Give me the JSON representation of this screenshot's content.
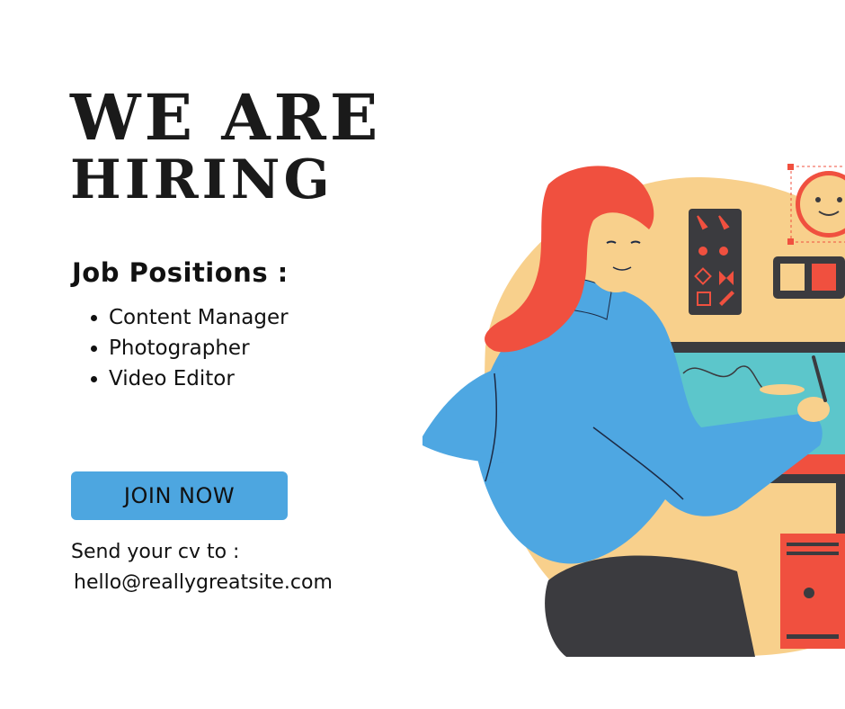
{
  "headline": {
    "line1": "WE ARE",
    "line2": "HIRING"
  },
  "positions": {
    "title": "Job Positions :",
    "items": [
      "Content Manager",
      "Photographer",
      "Video Editor"
    ]
  },
  "cta": {
    "label": "JOIN NOW"
  },
  "contact": {
    "label": "Send your cv to :",
    "email": "hello@reallygreatsite.com"
  },
  "colors": {
    "button": "#4da6e0",
    "blob": "#f8d08c",
    "hair": "#f0503f",
    "sweater": "#4ea7e2",
    "screen": "#5cc6cb",
    "dark": "#3b3b3f"
  },
  "illustration": {
    "subject": "woman-at-desk-icon"
  }
}
